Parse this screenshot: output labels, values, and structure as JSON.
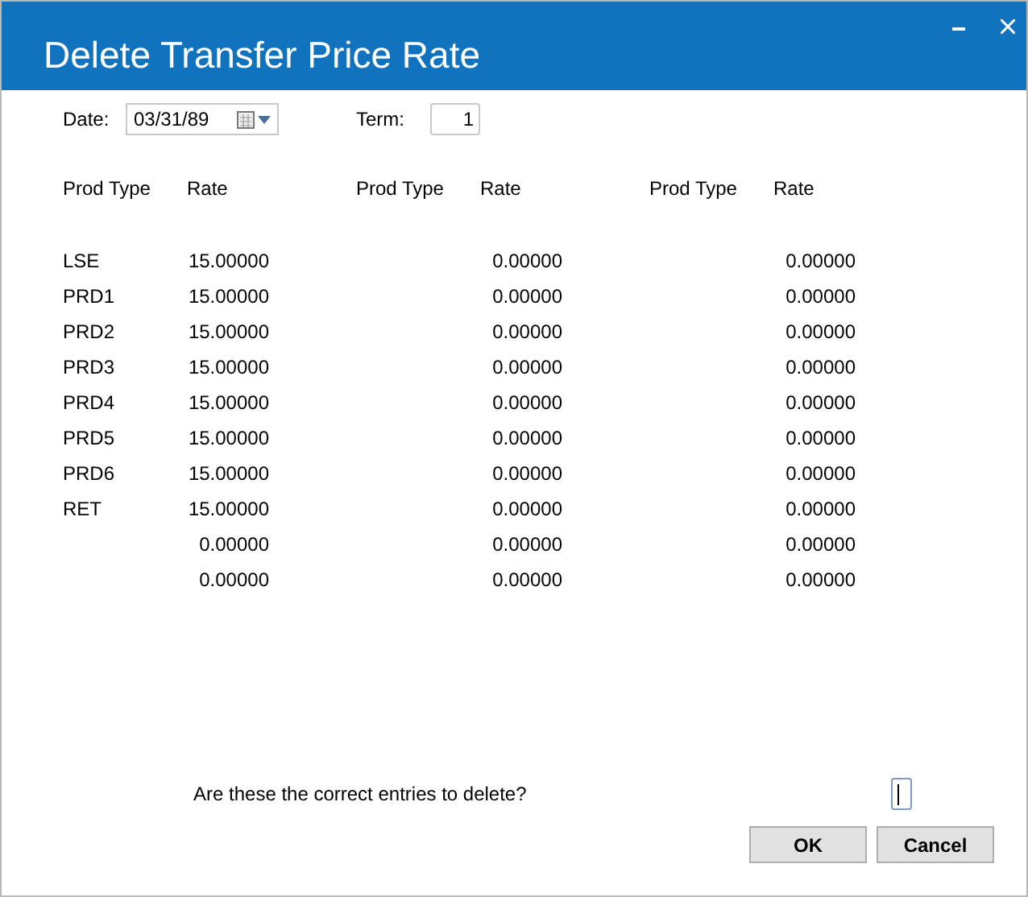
{
  "window": {
    "title": "Delete Transfer Price Rate"
  },
  "date": {
    "label": "Date:",
    "value": "03/31/89"
  },
  "term": {
    "label": "Term:",
    "value": "1"
  },
  "table": {
    "columns": [
      {
        "prod_type": "Prod Type",
        "rate": "Rate"
      },
      {
        "prod_type": "Prod Type",
        "rate": "Rate"
      },
      {
        "prod_type": "Prod Type",
        "rate": "Rate"
      }
    ],
    "rows": [
      [
        {
          "prod_type": "LSE",
          "rate": "15.00000"
        },
        {
          "rate": "0.00000"
        },
        {
          "rate": "0.00000"
        }
      ],
      [
        {
          "prod_type": "PRD1",
          "rate": "15.00000"
        },
        {
          "rate": "0.00000"
        },
        {
          "rate": "0.00000"
        }
      ],
      [
        {
          "prod_type": "PRD2",
          "rate": "15.00000"
        },
        {
          "rate": "0.00000"
        },
        {
          "rate": "0.00000"
        }
      ],
      [
        {
          "prod_type": "PRD3",
          "rate": "15.00000"
        },
        {
          "rate": "0.00000"
        },
        {
          "rate": "0.00000"
        }
      ],
      [
        {
          "prod_type": "PRD4",
          "rate": "15.00000"
        },
        {
          "rate": "0.00000"
        },
        {
          "rate": "0.00000"
        }
      ],
      [
        {
          "prod_type": "PRD5",
          "rate": "15.00000"
        },
        {
          "rate": "0.00000"
        },
        {
          "rate": "0.00000"
        }
      ],
      [
        {
          "prod_type": "PRD6",
          "rate": "15.00000"
        },
        {
          "rate": "0.00000"
        },
        {
          "rate": "0.00000"
        }
      ],
      [
        {
          "prod_type": "RET",
          "rate": "15.00000"
        },
        {
          "rate": "0.00000"
        },
        {
          "rate": "0.00000"
        }
      ],
      [
        {
          "rate": "0.00000"
        },
        {
          "rate": "0.00000"
        },
        {
          "rate": "0.00000"
        }
      ],
      [
        {
          "rate": "0.00000"
        },
        {
          "rate": "0.00000"
        },
        {
          "rate": "0.00000"
        }
      ]
    ]
  },
  "confirm": {
    "question": "Are these the correct entries to delete?"
  },
  "buttons": [
    "OK",
    "Cancel"
  ]
}
